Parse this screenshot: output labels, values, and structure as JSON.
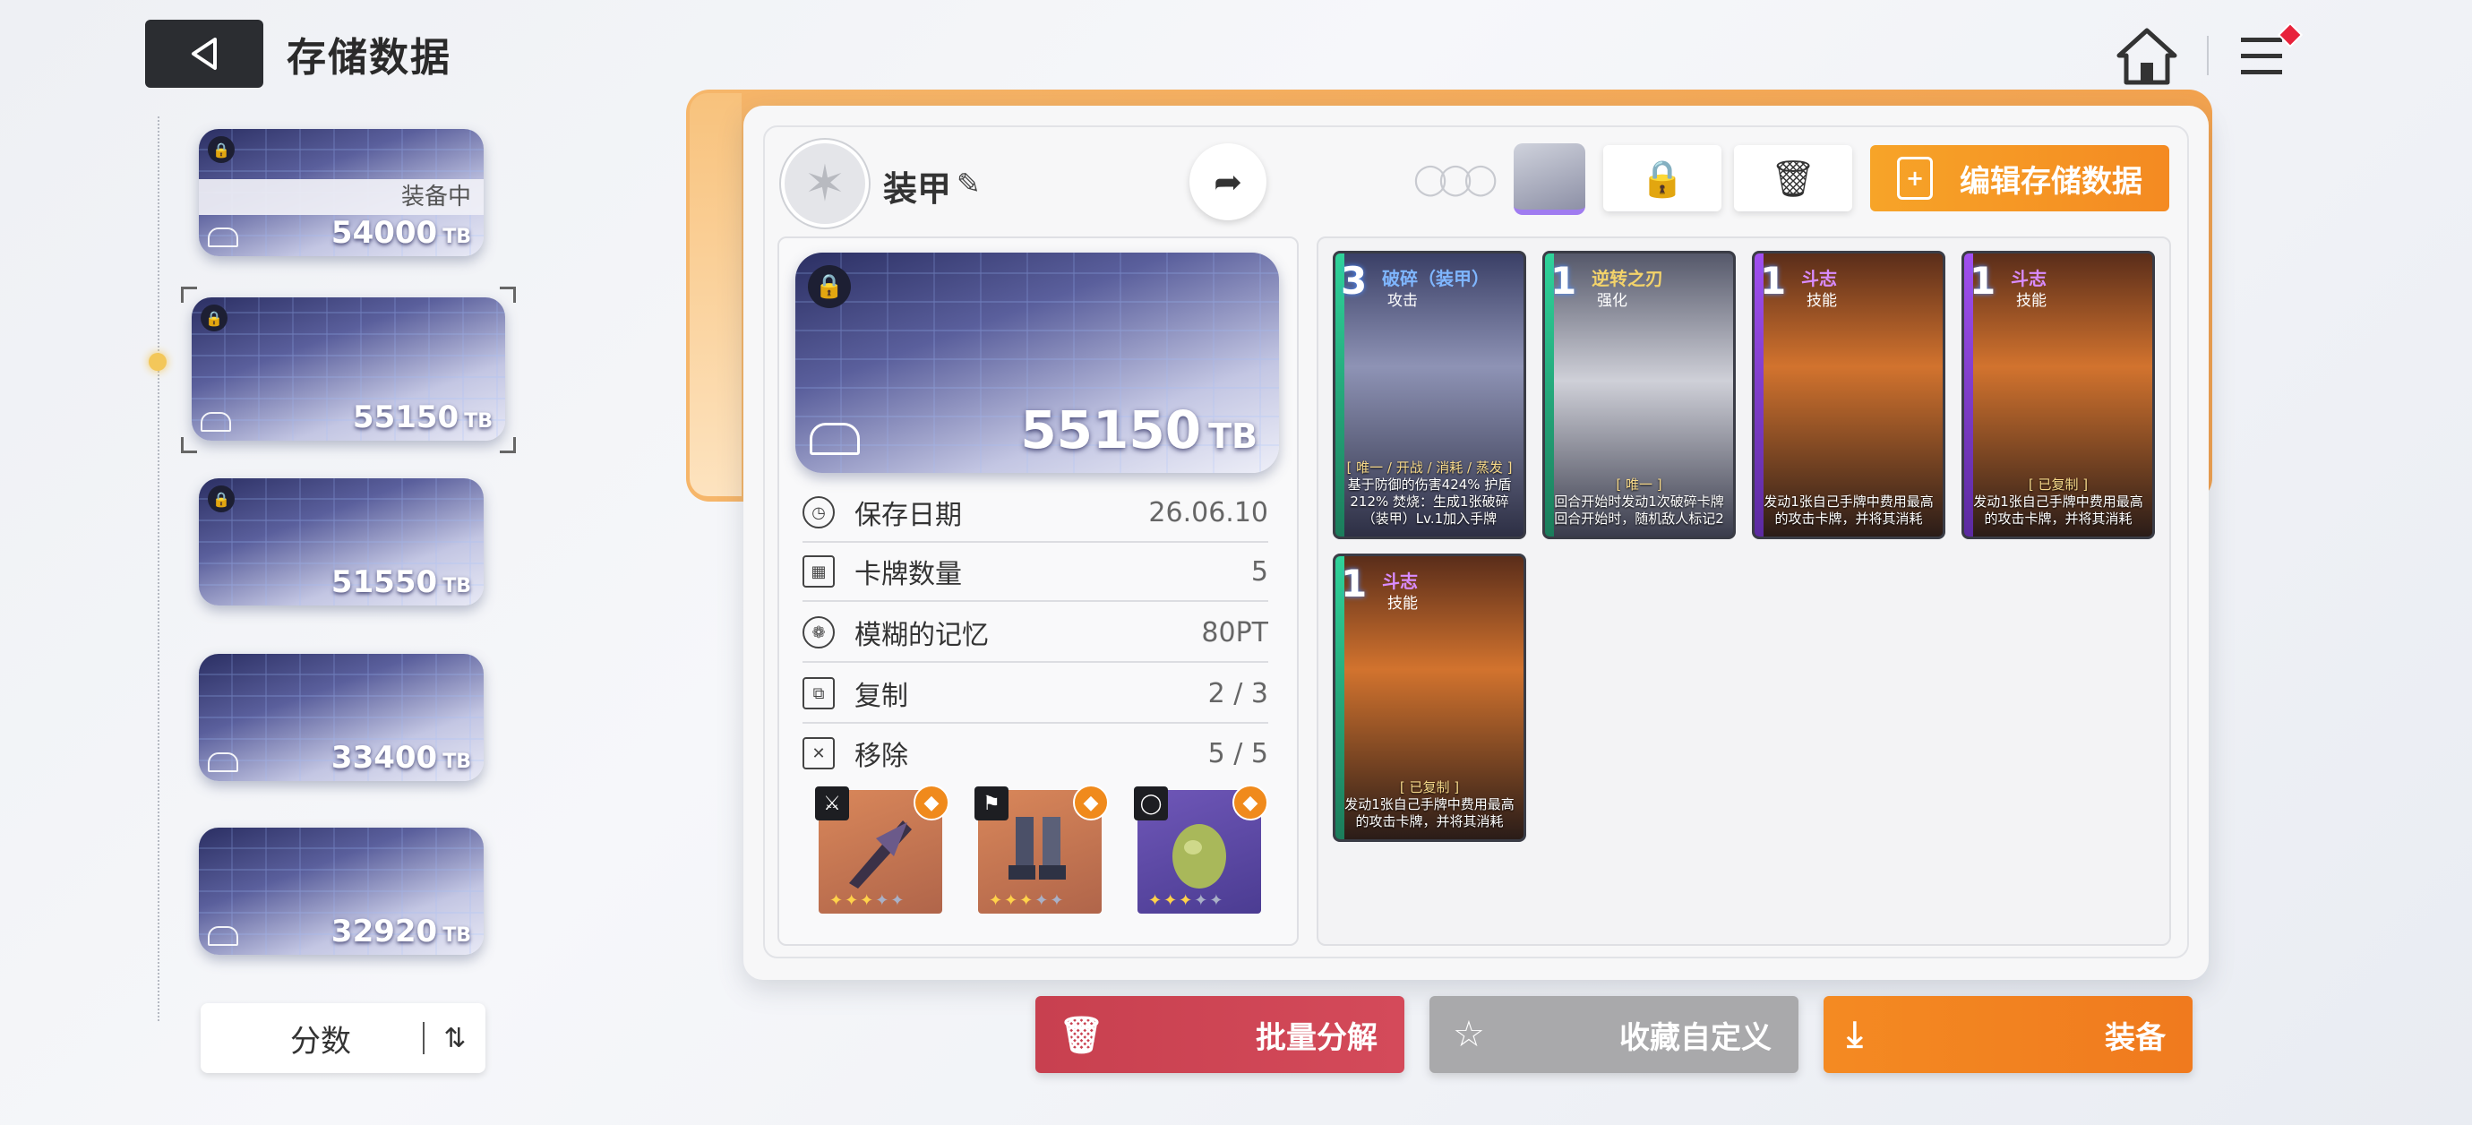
{
  "header": {
    "title": "存储数据"
  },
  "left_list": {
    "items": [
      {
        "score": "54000",
        "unit": "TB",
        "locked": true,
        "equipped_label": "装备中"
      },
      {
        "score": "55150",
        "unit": "TB",
        "locked": true,
        "selected": true
      },
      {
        "score": "51550",
        "unit": "TB",
        "locked": true
      },
      {
        "score": "33400",
        "unit": "TB",
        "locked": false
      },
      {
        "score": "32920",
        "unit": "TB",
        "locked": false
      }
    ],
    "sort_label": "分数"
  },
  "detail": {
    "name": "装甲",
    "edit_button_label": "编辑存储数据",
    "score": "55150",
    "unit": "TB",
    "stats": [
      {
        "label": "保存日期",
        "value": "26.06.10"
      },
      {
        "label": "卡牌数量",
        "value": "5"
      },
      {
        "label": "模糊的记忆",
        "value": "80PT"
      },
      {
        "label": "复制",
        "value": "2 / 3"
      },
      {
        "label": "移除",
        "value": "5 / 5"
      }
    ],
    "equipment": [
      {
        "slot": "weapon",
        "stars_filled": 3,
        "stars_total": 5
      },
      {
        "slot": "armor",
        "stars_filled": 3,
        "stars_total": 5
      },
      {
        "slot": "accessory",
        "stars_filled": 3,
        "stars_total": 5
      }
    ]
  },
  "cards": [
    {
      "cost": "3",
      "name": "破碎（装甲）",
      "type": "攻击",
      "desc_tag": "[ 唯一 / 开战 / 消耗 / 蒸发 ]",
      "desc": "基于防御的伤害424% 护盾212% 焚烧：生成1张破碎（装甲）Lv.1加入手牌",
      "name_color": "#7fb6ff"
    },
    {
      "cost": "1",
      "name": "逆转之刃",
      "type": "强化",
      "desc_tag": "[ 唯一 ]",
      "desc": "回合开始时发动1次破碎卡牌 回合开始时，随机敌人标记2",
      "name_color": "#f3d36a"
    },
    {
      "cost": "1",
      "name": "斗志",
      "type": "技能",
      "desc_tag": "",
      "desc": "发动1张自己手牌中费用最高的攻击卡牌，并将其消耗",
      "name_color": "#d98cff"
    },
    {
      "cost": "1",
      "name": "斗志",
      "type": "技能",
      "desc_tag": "[ 已复制 ]",
      "desc": "发动1张自己手牌中费用最高的攻击卡牌，并将其消耗",
      "name_color": "#d98cff"
    },
    {
      "cost": "1",
      "name": "斗志",
      "type": "技能",
      "desc_tag": "[ 已复制 ]",
      "desc": "发动1张自己手牌中费用最高的攻击卡牌，并将其消耗",
      "name_color": "#d98cff"
    }
  ],
  "bottom": {
    "dismantle_label": "批量分解",
    "custom_label": "收藏自定义",
    "equip_label": "装备"
  },
  "colors": {
    "accent_orange": "#f48a22",
    "danger_red": "#c8404f",
    "neutral_gray": "#a9a9ab"
  }
}
